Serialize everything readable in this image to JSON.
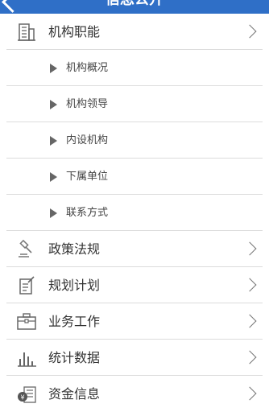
{
  "header": {
    "title": "信息公开"
  },
  "menu": [
    {
      "label": "机构职能",
      "icon": "building-icon"
    },
    {
      "label": "机构概况"
    },
    {
      "label": "机构领导"
    },
    {
      "label": "内设机构"
    },
    {
      "label": "下属单位"
    },
    {
      "label": "联系方式"
    },
    {
      "label": "政策法规",
      "icon": "gavel-icon"
    },
    {
      "label": "规划计划",
      "icon": "edit-document-icon"
    },
    {
      "label": "业务工作",
      "icon": "briefcase-icon"
    },
    {
      "label": "统计数据",
      "icon": "bar-chart-icon"
    },
    {
      "label": "资金信息",
      "icon": "money-icon"
    }
  ]
}
